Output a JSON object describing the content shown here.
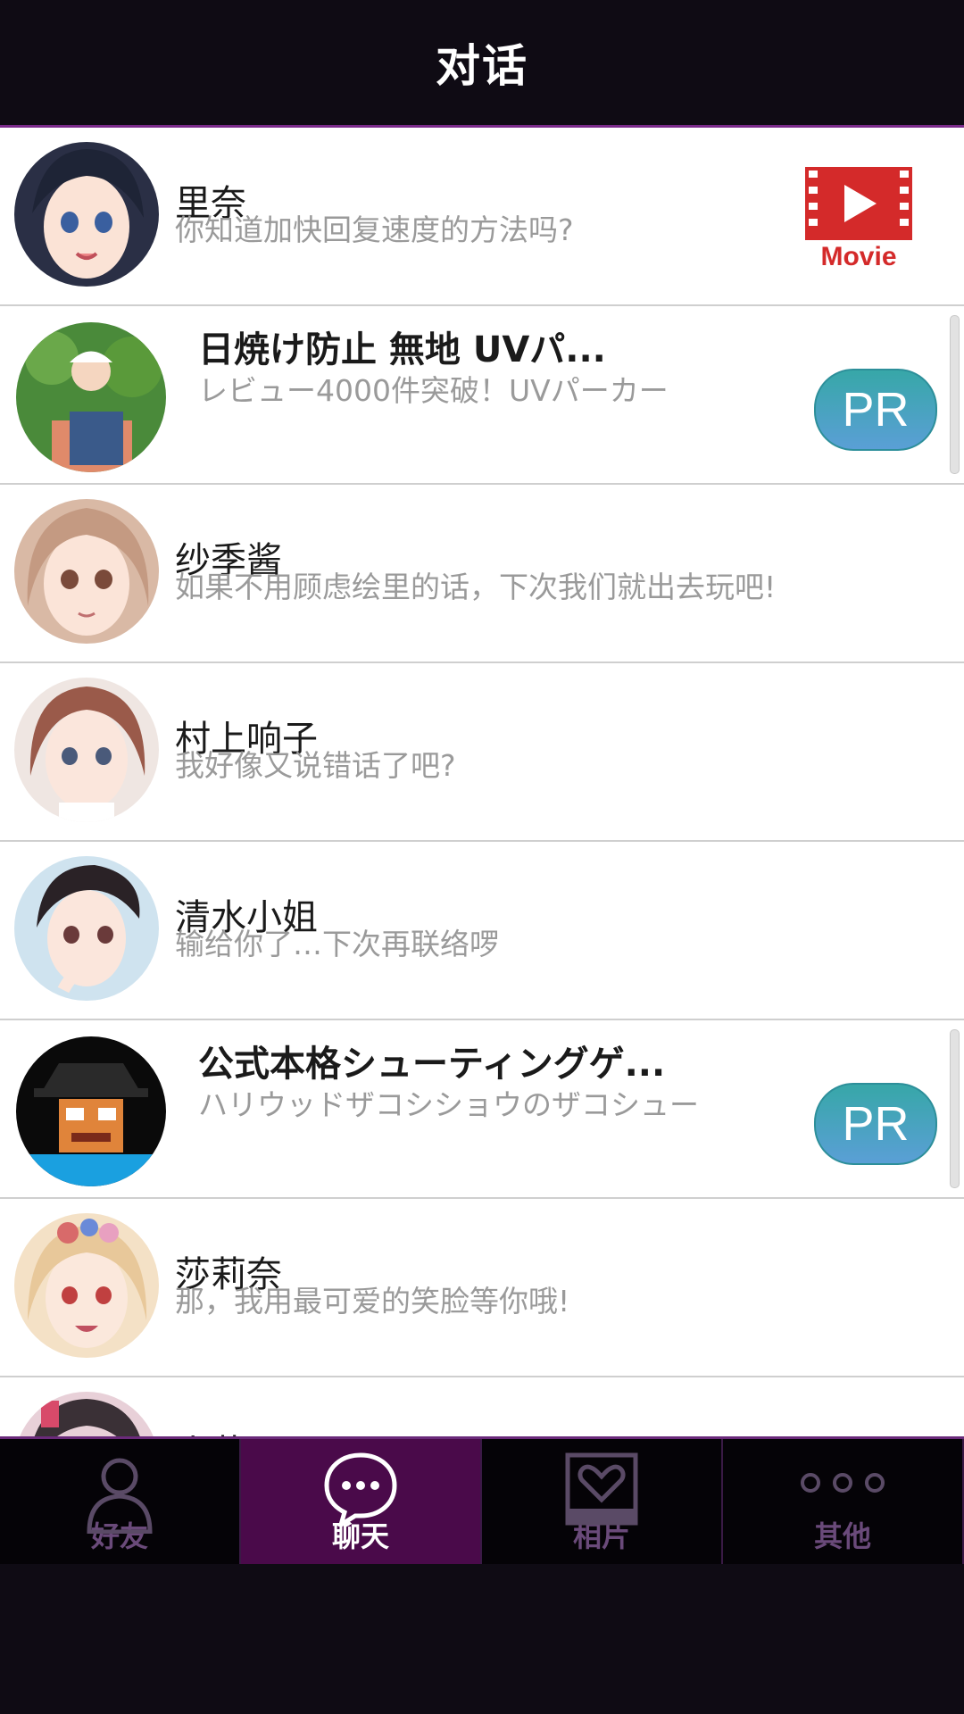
{
  "header": {
    "title": "对话"
  },
  "conversations": [
    {
      "name": "里奈",
      "message": "你知道加快回复速度的方法吗?",
      "badge": "Movie"
    },
    {
      "name": "日焼け防止 無地 UVパ...",
      "message": "レビュー4000件突破！UVパーカー",
      "badge": "PR",
      "is_ad": true
    },
    {
      "name": "纱季酱",
      "message": "如果不用顾虑绘里的话，下次我们就出去玩吧!"
    },
    {
      "name": "村上响子",
      "message": "我好像又说错话了吧?"
    },
    {
      "name": "清水小姐",
      "message": "输给你了…下次再联络啰"
    },
    {
      "name": "公式本格シューティングゲ...",
      "message": "ハリウッドザコシショウのザコシュー",
      "badge": "PR",
      "is_ad": true
    },
    {
      "name": "莎莉奈",
      "message": "那，我用最可爱的笑脸等你哦!"
    },
    {
      "name": "小花",
      "message": ""
    }
  ],
  "tabs": [
    {
      "label": "好友",
      "icon": "person-icon",
      "active": false
    },
    {
      "label": "聊天",
      "icon": "chat-bubble-icon",
      "active": true
    },
    {
      "label": "相片",
      "icon": "photo-heart-icon",
      "active": false
    },
    {
      "label": "其他",
      "icon": "more-dots-icon",
      "active": false
    }
  ],
  "colors": {
    "accent": "#7a2a8a",
    "active_tab": "#4a0a4a",
    "pr_badge": "#37a7a8",
    "movie_red": "#d42a2a"
  }
}
